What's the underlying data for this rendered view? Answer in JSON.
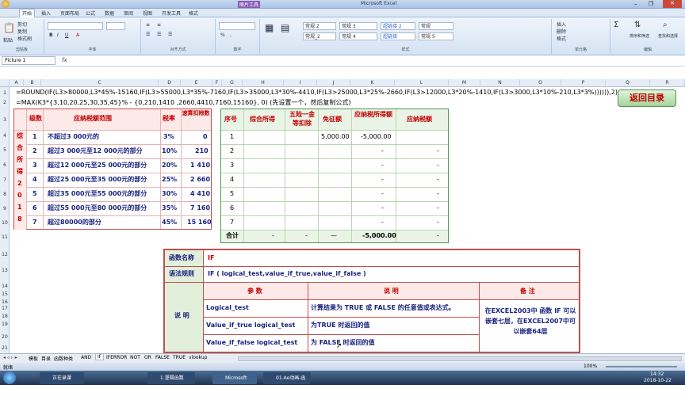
{
  "window": {
    "title": "Microsoft Excel",
    "title_badge": "图片工具"
  },
  "ribbon_tabs": [
    "开始",
    "插入",
    "页面布局",
    "公式",
    "数据",
    "审阅",
    "视图",
    "开发工具",
    "格式"
  ],
  "ribbon": {
    "paste": "粘贴",
    "cut": "剪切",
    "copy": "复制",
    "format_painter": "格式刷",
    "clipboard": "剪贴板",
    "font": "字体",
    "alignment": "对齐方式",
    "number": "数字",
    "styles": "样式",
    "cells": "单元格",
    "editing": "编辑",
    "style_boxes": [
      "常规 2",
      "常规 3",
      "超链接 2",
      "常规",
      "常规_2",
      "常规 4",
      "超链接",
      "常规 5"
    ],
    "insert": "插入",
    "delete": "删除",
    "format": "格式",
    "sort_filter": "排序和筛选",
    "find_select": "查找和选择"
  },
  "name_box": "Picture 1",
  "formulas": [
    "=ROUND(IF(L3>80000,L3*45%-15160,IF(L3>55000,L3*35%-7160,IF(L3>35000,L3*30%-4410,IF(L3>25000,L3*25%-2660,IF(L3>12000,L3*20%-1410,IF(L3>3000,L3*10%-210,L3*3%)))))),2)",
    "=MAX(K3*{3,10,20,25,30,35,45}% - {0,210,1410 ,2660,4410,7160,15160}, 0)  (先设置一个，然后复制公式)"
  ],
  "columns": [
    "A",
    "B",
    "C",
    "D",
    "E",
    "F",
    "G",
    "H",
    "I",
    "J",
    "K",
    "L",
    "M",
    "N",
    "O",
    "P",
    "Q",
    "R"
  ],
  "rows": [
    "1",
    "2",
    "3",
    "4",
    "5",
    "6",
    "7",
    "8",
    "9",
    "10",
    "11",
    "12",
    "13",
    "14",
    "15",
    "16",
    "17",
    "18",
    "19",
    "20",
    "21"
  ],
  "back_button": "返回目录",
  "tax_table": {
    "headers": [
      "级数",
      "应纳税额范围",
      "税率",
      "速算扣除数"
    ],
    "side_label": [
      "综",
      "合",
      "所",
      "得",
      "2",
      "0",
      "1",
      "8"
    ],
    "rows": [
      [
        "1",
        "不超过3 000元的",
        "3%",
        "0"
      ],
      [
        "2",
        "超过3 000元至12 000元的部分",
        "10%",
        "210"
      ],
      [
        "3",
        "超过12 000元至25 000元的部分",
        "20%",
        "1 410"
      ],
      [
        "4",
        "超过25 000元至35 000元的部分",
        "25%",
        "2 660"
      ],
      [
        "5",
        "超过35 000元至55 000元的部分",
        "30%",
        "4 410"
      ],
      [
        "6",
        "超过55 000元至80 000元的部分",
        "35%",
        "7 160"
      ],
      [
        "7",
        "超过80000的部分",
        "45%",
        "15 160"
      ]
    ]
  },
  "calc_table": {
    "headers": [
      "序号",
      "综合所得",
      "五险一金等扣除",
      "免征额",
      "应纳税所得额",
      "应纳税额"
    ],
    "rows": [
      [
        "1",
        "",
        "",
        "5,000.00",
        "-5,000.00",
        ""
      ],
      [
        "2",
        "",
        "",
        "",
        "-",
        "-"
      ],
      [
        "3",
        "",
        "",
        "",
        "-",
        "-"
      ],
      [
        "4",
        "",
        "",
        "",
        "-",
        "-"
      ],
      [
        "5",
        "",
        "",
        "",
        "-",
        "-"
      ],
      [
        "6",
        "",
        "",
        "",
        "-",
        "-"
      ],
      [
        "7",
        "",
        "",
        "",
        "-",
        "-"
      ]
    ],
    "total": [
      "合计",
      "-",
      "-",
      "—",
      "-5,000.00",
      "-"
    ]
  },
  "func_table": {
    "name_label": "函数名称",
    "name_value": "IF",
    "syntax_label": "语法规则",
    "syntax_value": "IF  ( logical_test,value_if_true,value_if_false )",
    "desc_label": "说 明",
    "col_param": "参 数",
    "col_desc": "说 明",
    "col_note": "备 注",
    "params": [
      [
        "Logical_test",
        "计算结果为 TRUE 或 FALSE 的任意值或表达式。"
      ],
      [
        "Value_if_true logical_test",
        "为TRUE 时返回的值"
      ],
      [
        "Value_if_false logical_test",
        "为 FALSE 时返回的值"
      ]
    ],
    "note": "在EXCEL2003中 函数 IF 可以嵌套七层，在EXCEL2007中可以嵌套64层"
  },
  "sheet_tabs": [
    "模板",
    "目录",
    "函数种类",
    "AND",
    "IF",
    "IFERROR",
    "NOT",
    "OR",
    "FALSE",
    "TRUE",
    "vlookup"
  ],
  "status": {
    "mode": "就绪",
    "zoom": "100%"
  },
  "taskbar": {
    "items": [
      "正在录课",
      "1.逻辑函数",
      "Microsoft Excel ...",
      "01.Ae动画-函数..."
    ],
    "time": "14:32",
    "date": "2018-10-22"
  }
}
